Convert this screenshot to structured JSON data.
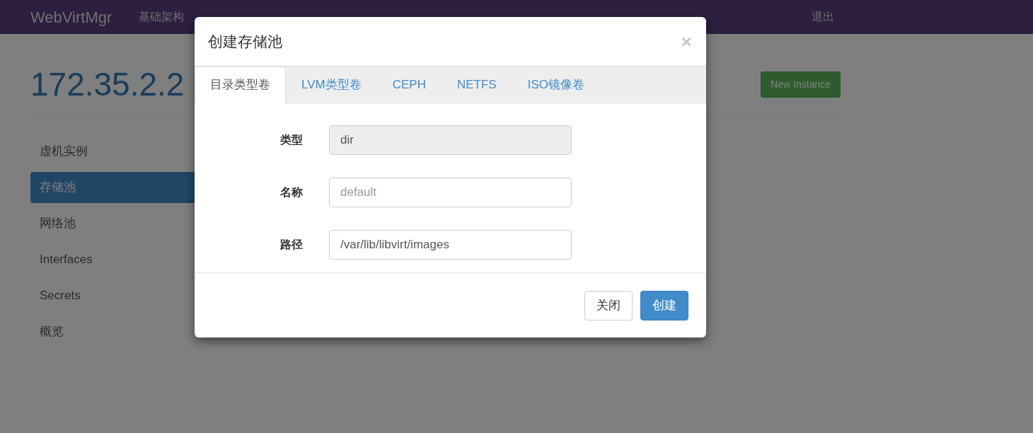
{
  "navbar": {
    "brand": "WebVirtMgr",
    "items": [
      "基础架构"
    ],
    "logout": "退出"
  },
  "page": {
    "title": "172.35.2.2",
    "new_instance": "New Instance"
  },
  "sidebar": {
    "items": [
      {
        "label": "虚机实例",
        "selected": false
      },
      {
        "label": "存储池",
        "selected": true
      },
      {
        "label": "网络池",
        "selected": false
      },
      {
        "label": "Interfaces",
        "selected": false
      },
      {
        "label": "Secrets",
        "selected": false
      },
      {
        "label": "概览",
        "selected": false
      }
    ]
  },
  "modal": {
    "title": "创建存储池",
    "close": "×",
    "tabs": [
      {
        "label": "目录类型卷",
        "selected": true
      },
      {
        "label": "LVM类型卷",
        "selected": false
      },
      {
        "label": "CEPH",
        "selected": false
      },
      {
        "label": "NETFS",
        "selected": false
      },
      {
        "label": "ISO镜像卷",
        "selected": false
      }
    ],
    "fields": [
      {
        "label": "类型",
        "value": "dir",
        "disabled": true
      },
      {
        "label": "名称",
        "placeholder": "default",
        "disabled": false
      },
      {
        "label": "路径",
        "value": "/var/lib/libvirt/images",
        "disabled": false
      }
    ],
    "buttons": [
      {
        "label": "关闭",
        "kind": "default"
      },
      {
        "label": "创建",
        "kind": "primary"
      }
    ]
  }
}
